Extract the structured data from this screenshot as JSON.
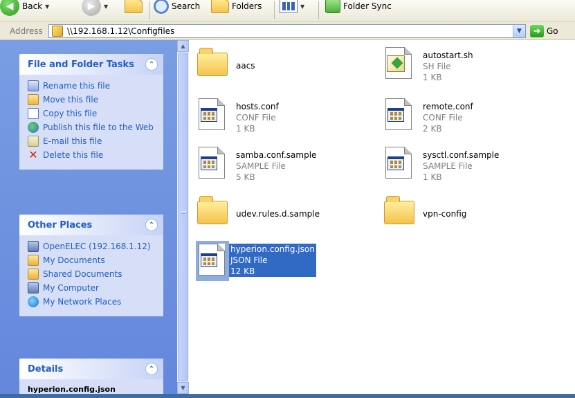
{
  "toolbar": {
    "back_label": "Back",
    "search_label": "Search",
    "folders_label": "Folders",
    "sync_label": "Folder Sync"
  },
  "address": {
    "label": "Address",
    "value": "\\\\192.168.1.12\\Configfiles",
    "go_label": "Go"
  },
  "tasks": {
    "file_folder": {
      "title": "File and Folder Tasks",
      "items": [
        {
          "label": "Rename this file",
          "icon": "rename-icon"
        },
        {
          "label": "Move this file",
          "icon": "move-icon"
        },
        {
          "label": "Copy this file",
          "icon": "copy-icon"
        },
        {
          "label": "Publish this file to the Web",
          "icon": "publish-web-icon"
        },
        {
          "label": "E-mail this file",
          "icon": "email-icon"
        },
        {
          "label": "Delete this file",
          "icon": "delete-icon"
        }
      ]
    },
    "other_places": {
      "title": "Other Places",
      "items": [
        {
          "label": "OpenELEC (192.168.1.12)",
          "icon": "network-computer-icon"
        },
        {
          "label": "My Documents",
          "icon": "folder-icon"
        },
        {
          "label": "Shared Documents",
          "icon": "folder-icon"
        },
        {
          "label": "My Computer",
          "icon": "computer-icon"
        },
        {
          "label": "My Network Places",
          "icon": "network-places-icon"
        }
      ]
    },
    "details": {
      "title": "Details",
      "cut_text": "hyperion.config.json"
    }
  },
  "files": [
    {
      "name": "aacs",
      "kind": "folder"
    },
    {
      "name": "autostart.sh",
      "type": "SH File",
      "size": "1 KB",
      "kind": "script"
    },
    {
      "name": "hosts.conf",
      "type": "CONF File",
      "size": "1 KB",
      "kind": "doc"
    },
    {
      "name": "remote.conf",
      "type": "CONF File",
      "size": "2 KB",
      "kind": "doc"
    },
    {
      "name": "samba.conf.sample",
      "type": "SAMPLE File",
      "size": "5 KB",
      "kind": "doc"
    },
    {
      "name": "sysctl.conf.sample",
      "type": "SAMPLE File",
      "size": "1 KB",
      "kind": "doc"
    },
    {
      "name": "udev.rules.d.sample",
      "kind": "folder"
    },
    {
      "name": "vpn-config",
      "kind": "folder"
    },
    {
      "name": "hyperion.config.json",
      "type": "JSON File",
      "size": "12 KB",
      "kind": "doc",
      "selected": true
    }
  ],
  "colors": {
    "task_pane": "#6d8fe0",
    "task_link": "#215dc6",
    "selection": "#316ac5"
  }
}
